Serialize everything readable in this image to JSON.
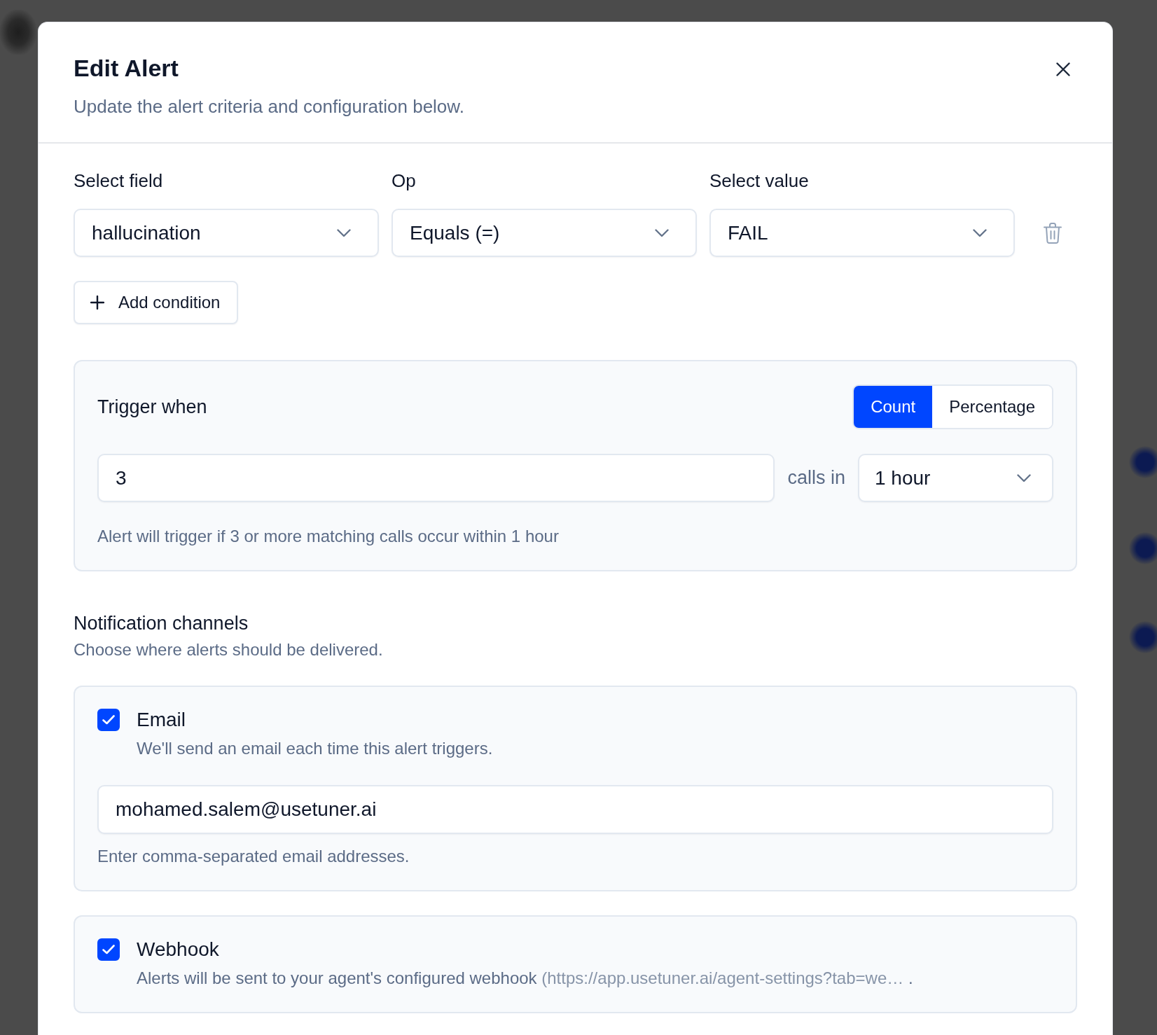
{
  "dialog": {
    "title": "Edit Alert",
    "subtitle": "Update the alert criteria and configuration below."
  },
  "conditions": {
    "columns": [
      "Select field",
      "Op",
      "Select value"
    ],
    "rows": [
      {
        "field": "hallucination",
        "op": "Equals (=)",
        "value": "FAIL"
      }
    ],
    "add_button": "Add condition"
  },
  "trigger": {
    "title": "Trigger when",
    "modes": [
      {
        "label": "Count",
        "selected": true
      },
      {
        "label": "Percentage",
        "selected": false
      }
    ],
    "threshold": "3",
    "unit_label": "calls in",
    "window": "1 hour",
    "help": "Alert will trigger if 3 or more matching calls occur within 1 hour"
  },
  "notifications": {
    "title": "Notification channels",
    "subtitle": "Choose where alerts should be delivered.",
    "channels": [
      {
        "kind": "email",
        "name": "Email",
        "checked": true,
        "description": "We'll send an email each time this alert triggers.",
        "value": "mohamed.salem@usetuner.ai",
        "help": "Enter comma-separated email addresses."
      },
      {
        "kind": "webhook",
        "name": "Webhook",
        "checked": true,
        "description": "Alerts will be sent to your agent's configured webhook",
        "url": "(https://app.usetuner.ai/agent-settings?tab=we…",
        "description_end": "."
      }
    ]
  }
}
